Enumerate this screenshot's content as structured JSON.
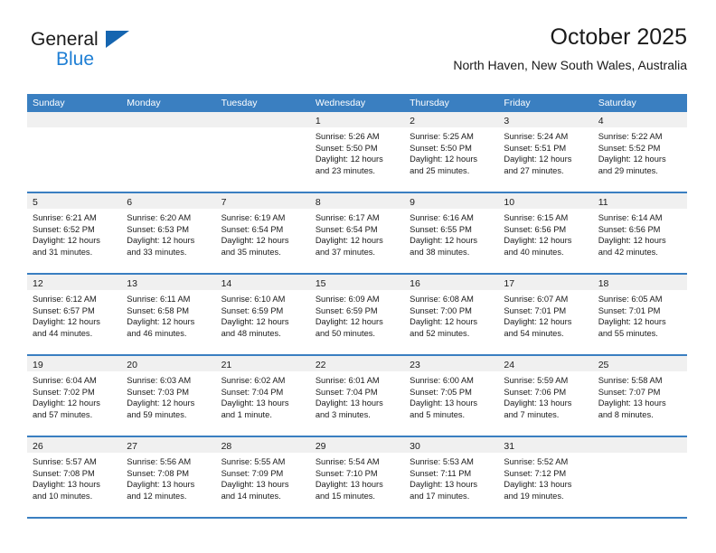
{
  "brand": {
    "word_one": "General",
    "word_two": "Blue",
    "triangle_icon": "triangle-icon",
    "primary_color": "#1565b0",
    "accent_color": "#1f7fd4"
  },
  "header": {
    "month_title": "October 2025",
    "location": "North Haven, New South Wales, Australia"
  },
  "calendar": {
    "header_color": "#3a7fc1",
    "band_color": "#f0f0f0",
    "weekdays": [
      "Sunday",
      "Monday",
      "Tuesday",
      "Wednesday",
      "Thursday",
      "Friday",
      "Saturday"
    ],
    "weeks": [
      [
        {
          "day": "",
          "lines": []
        },
        {
          "day": "",
          "lines": []
        },
        {
          "day": "",
          "lines": []
        },
        {
          "day": "1",
          "lines": [
            "Sunrise: 5:26 AM",
            "Sunset: 5:50 PM",
            "Daylight: 12 hours",
            "and 23 minutes."
          ]
        },
        {
          "day": "2",
          "lines": [
            "Sunrise: 5:25 AM",
            "Sunset: 5:50 PM",
            "Daylight: 12 hours",
            "and 25 minutes."
          ]
        },
        {
          "day": "3",
          "lines": [
            "Sunrise: 5:24 AM",
            "Sunset: 5:51 PM",
            "Daylight: 12 hours",
            "and 27 minutes."
          ]
        },
        {
          "day": "4",
          "lines": [
            "Sunrise: 5:22 AM",
            "Sunset: 5:52 PM",
            "Daylight: 12 hours",
            "and 29 minutes."
          ]
        }
      ],
      [
        {
          "day": "5",
          "lines": [
            "Sunrise: 6:21 AM",
            "Sunset: 6:52 PM",
            "Daylight: 12 hours",
            "and 31 minutes."
          ]
        },
        {
          "day": "6",
          "lines": [
            "Sunrise: 6:20 AM",
            "Sunset: 6:53 PM",
            "Daylight: 12 hours",
            "and 33 minutes."
          ]
        },
        {
          "day": "7",
          "lines": [
            "Sunrise: 6:19 AM",
            "Sunset: 6:54 PM",
            "Daylight: 12 hours",
            "and 35 minutes."
          ]
        },
        {
          "day": "8",
          "lines": [
            "Sunrise: 6:17 AM",
            "Sunset: 6:54 PM",
            "Daylight: 12 hours",
            "and 37 minutes."
          ]
        },
        {
          "day": "9",
          "lines": [
            "Sunrise: 6:16 AM",
            "Sunset: 6:55 PM",
            "Daylight: 12 hours",
            "and 38 minutes."
          ]
        },
        {
          "day": "10",
          "lines": [
            "Sunrise: 6:15 AM",
            "Sunset: 6:56 PM",
            "Daylight: 12 hours",
            "and 40 minutes."
          ]
        },
        {
          "day": "11",
          "lines": [
            "Sunrise: 6:14 AM",
            "Sunset: 6:56 PM",
            "Daylight: 12 hours",
            "and 42 minutes."
          ]
        }
      ],
      [
        {
          "day": "12",
          "lines": [
            "Sunrise: 6:12 AM",
            "Sunset: 6:57 PM",
            "Daylight: 12 hours",
            "and 44 minutes."
          ]
        },
        {
          "day": "13",
          "lines": [
            "Sunrise: 6:11 AM",
            "Sunset: 6:58 PM",
            "Daylight: 12 hours",
            "and 46 minutes."
          ]
        },
        {
          "day": "14",
          "lines": [
            "Sunrise: 6:10 AM",
            "Sunset: 6:59 PM",
            "Daylight: 12 hours",
            "and 48 minutes."
          ]
        },
        {
          "day": "15",
          "lines": [
            "Sunrise: 6:09 AM",
            "Sunset: 6:59 PM",
            "Daylight: 12 hours",
            "and 50 minutes."
          ]
        },
        {
          "day": "16",
          "lines": [
            "Sunrise: 6:08 AM",
            "Sunset: 7:00 PM",
            "Daylight: 12 hours",
            "and 52 minutes."
          ]
        },
        {
          "day": "17",
          "lines": [
            "Sunrise: 6:07 AM",
            "Sunset: 7:01 PM",
            "Daylight: 12 hours",
            "and 54 minutes."
          ]
        },
        {
          "day": "18",
          "lines": [
            "Sunrise: 6:05 AM",
            "Sunset: 7:01 PM",
            "Daylight: 12 hours",
            "and 55 minutes."
          ]
        }
      ],
      [
        {
          "day": "19",
          "lines": [
            "Sunrise: 6:04 AM",
            "Sunset: 7:02 PM",
            "Daylight: 12 hours",
            "and 57 minutes."
          ]
        },
        {
          "day": "20",
          "lines": [
            "Sunrise: 6:03 AM",
            "Sunset: 7:03 PM",
            "Daylight: 12 hours",
            "and 59 minutes."
          ]
        },
        {
          "day": "21",
          "lines": [
            "Sunrise: 6:02 AM",
            "Sunset: 7:04 PM",
            "Daylight: 13 hours",
            "and 1 minute."
          ]
        },
        {
          "day": "22",
          "lines": [
            "Sunrise: 6:01 AM",
            "Sunset: 7:04 PM",
            "Daylight: 13 hours",
            "and 3 minutes."
          ]
        },
        {
          "day": "23",
          "lines": [
            "Sunrise: 6:00 AM",
            "Sunset: 7:05 PM",
            "Daylight: 13 hours",
            "and 5 minutes."
          ]
        },
        {
          "day": "24",
          "lines": [
            "Sunrise: 5:59 AM",
            "Sunset: 7:06 PM",
            "Daylight: 13 hours",
            "and 7 minutes."
          ]
        },
        {
          "day": "25",
          "lines": [
            "Sunrise: 5:58 AM",
            "Sunset: 7:07 PM",
            "Daylight: 13 hours",
            "and 8 minutes."
          ]
        }
      ],
      [
        {
          "day": "26",
          "lines": [
            "Sunrise: 5:57 AM",
            "Sunset: 7:08 PM",
            "Daylight: 13 hours",
            "and 10 minutes."
          ]
        },
        {
          "day": "27",
          "lines": [
            "Sunrise: 5:56 AM",
            "Sunset: 7:08 PM",
            "Daylight: 13 hours",
            "and 12 minutes."
          ]
        },
        {
          "day": "28",
          "lines": [
            "Sunrise: 5:55 AM",
            "Sunset: 7:09 PM",
            "Daylight: 13 hours",
            "and 14 minutes."
          ]
        },
        {
          "day": "29",
          "lines": [
            "Sunrise: 5:54 AM",
            "Sunset: 7:10 PM",
            "Daylight: 13 hours",
            "and 15 minutes."
          ]
        },
        {
          "day": "30",
          "lines": [
            "Sunrise: 5:53 AM",
            "Sunset: 7:11 PM",
            "Daylight: 13 hours",
            "and 17 minutes."
          ]
        },
        {
          "day": "31",
          "lines": [
            "Sunrise: 5:52 AM",
            "Sunset: 7:12 PM",
            "Daylight: 13 hours",
            "and 19 minutes."
          ]
        },
        {
          "day": "",
          "lines": []
        }
      ]
    ]
  }
}
